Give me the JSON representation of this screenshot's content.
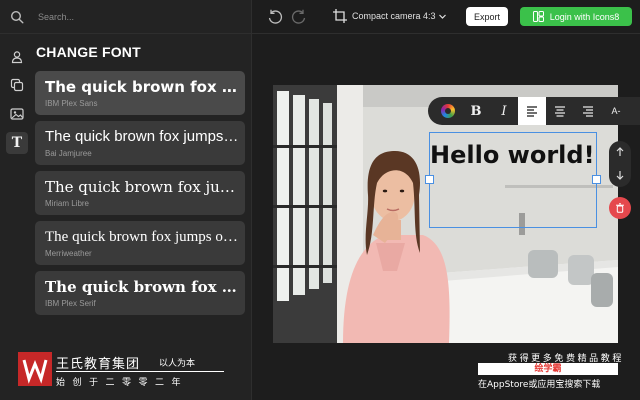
{
  "search": {
    "placeholder": "Search..."
  },
  "rail": {
    "items": [
      {
        "icon": "person-icon"
      },
      {
        "icon": "layers-icon"
      },
      {
        "icon": "image-icon"
      },
      {
        "icon": "text-icon",
        "glyph": "T",
        "active": true
      }
    ]
  },
  "panel": {
    "title": "CHANGE FONT",
    "fonts": [
      {
        "sample": "The quick brown fox jumps over the lazy dog",
        "name": "IBM Plex Sans",
        "selected": true
      },
      {
        "sample": "The quick brown fox jumps over the lazy dog",
        "name": "Bai Jamjuree"
      },
      {
        "sample": "The quick brown fox jumps over the lazy dog",
        "name": "Miriam Libre"
      },
      {
        "sample": "The quick brown fox jumps over the lazy dog",
        "name": "Merriweather"
      },
      {
        "sample": "The quick brown fox jumps over the lazy dog",
        "name": "IBM Plex Serif"
      }
    ]
  },
  "topbar": {
    "camera_label": "Compact camera",
    "camera_ratio": "4:3",
    "export_label": "Export",
    "login_label": "Login with Icons8"
  },
  "editor": {
    "text": "Hello world!",
    "toolbar": {
      "bold": "B",
      "italic": "I",
      "size": "A-"
    }
  },
  "colors": {
    "accent_green": "#3bc14a",
    "selection_blue": "#4a90e2",
    "delete_red": "#e5484d"
  },
  "watermark": {
    "name": "王氏教育集团",
    "slogan": "以人为本",
    "sub": "始创于二零零二年",
    "right_line1": "获得更多免费精品教程",
    "right_line2": "绘学霸",
    "right_line3": "在AppStore或应用宝搜索下载"
  }
}
